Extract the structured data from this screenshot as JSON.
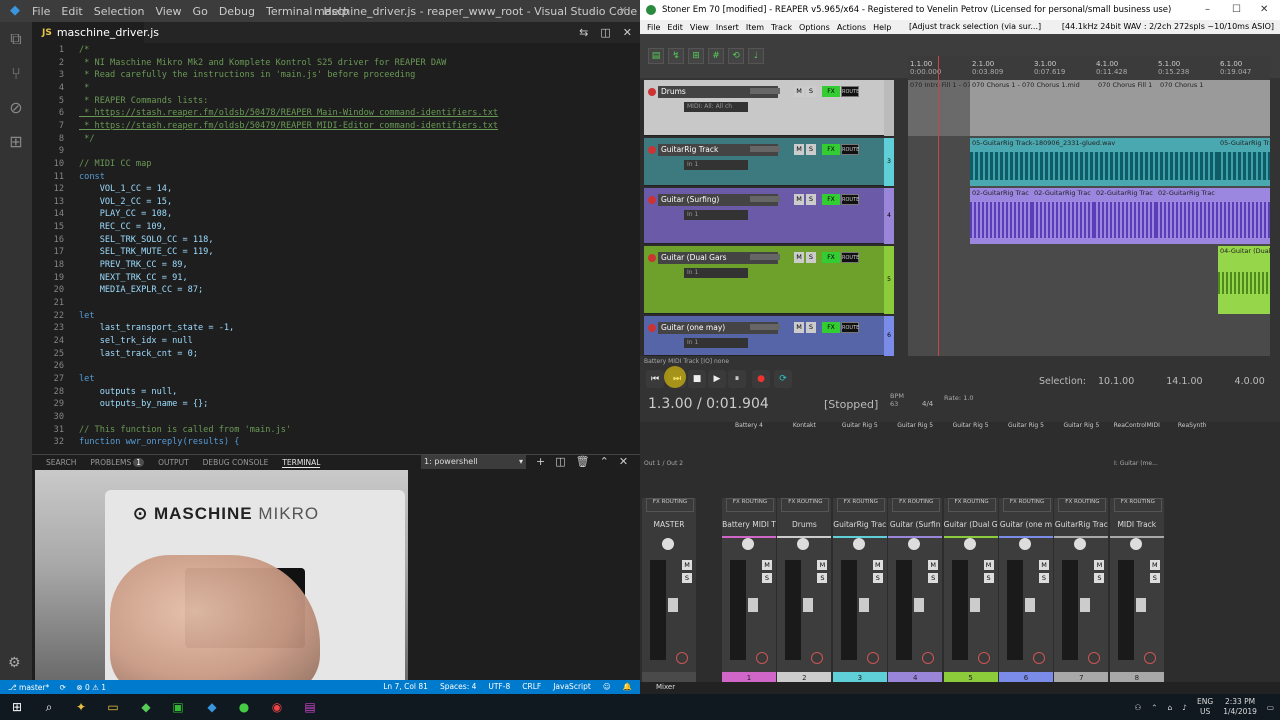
{
  "vscode": {
    "menu": [
      "File",
      "Edit",
      "Selection",
      "View",
      "Go",
      "Debug",
      "Terminal",
      "Help"
    ],
    "title": "maschine_driver.js - reaper_www_root - Visual Studio Code",
    "tab": "maschine_driver.js",
    "lines": [
      {
        "n": "1",
        "t": "/*"
      },
      {
        "n": "2",
        "t": " * NI Maschine Mikro Mk2 and Komplete Kontrol S25 driver for REAPER DAW"
      },
      {
        "n": "3",
        "t": " * Read carefully the instructions in 'main.js' before proceeding"
      },
      {
        "n": "4",
        "t": " *"
      },
      {
        "n": "5",
        "t": " * REAPER Commands lists:"
      },
      {
        "n": "6",
        "t": " * https://stash.reaper.fm/oldsb/50478/REAPER_Main-Window_command-identifiers.txt"
      },
      {
        "n": "7",
        "t": " * https://stash.reaper.fm/oldsb/50479/REAPER_MIDI-Editor_command-identifiers.txt"
      },
      {
        "n": "8",
        "t": " */"
      },
      {
        "n": "9",
        "t": ""
      },
      {
        "n": "10",
        "t": "// MIDI CC map"
      },
      {
        "n": "11",
        "t": "const"
      },
      {
        "n": "12",
        "t": "    VOL_1_CC = 14,"
      },
      {
        "n": "13",
        "t": "    VOL_2_CC = 15,"
      },
      {
        "n": "14",
        "t": "    PLAY_CC = 108,"
      },
      {
        "n": "15",
        "t": "    REC_CC = 109,"
      },
      {
        "n": "16",
        "t": "    SEL_TRK_SOLO_CC = 118,"
      },
      {
        "n": "17",
        "t": "    SEL_TRK_MUTE_CC = 119,"
      },
      {
        "n": "18",
        "t": "    PREV_TRK_CC = 89,"
      },
      {
        "n": "19",
        "t": "    NEXT_TRK_CC = 91,"
      },
      {
        "n": "20",
        "t": "    MEDIA_EXPLR_CC = 87;"
      },
      {
        "n": "21",
        "t": ""
      },
      {
        "n": "22",
        "t": "let"
      },
      {
        "n": "23",
        "t": "    last_transport_state = -1,"
      },
      {
        "n": "24",
        "t": "    sel_trk_idx = null"
      },
      {
        "n": "25",
        "t": "    last_track_cnt = 0;"
      },
      {
        "n": "26",
        "t": ""
      },
      {
        "n": "27",
        "t": "let"
      },
      {
        "n": "28",
        "t": "    outputs = null,"
      },
      {
        "n": "29",
        "t": "    outputs_by_name = {};"
      },
      {
        "n": "30",
        "t": ""
      },
      {
        "n": "31",
        "t": "// This function is called from 'main.js'"
      },
      {
        "n": "32",
        "t": "function wwr_onreply(results) {"
      }
    ],
    "panel_tabs": [
      "SEARCH",
      "PROBLEMS",
      "OUTPUT",
      "DEBUG CONSOLE",
      "TERMINAL"
    ],
    "problems_count": "1",
    "shell": "1: powershell",
    "webcam_brand": "MASCHINE",
    "webcam_brand2": "MIKRO",
    "status": {
      "branch": "master*",
      "errors": "0",
      "warnings": "1",
      "pos": "Ln 7, Col 81",
      "spaces": "Spaces: 4",
      "enc": "UTF-8",
      "eol": "CRLF",
      "lang": "JavaScript"
    }
  },
  "reaper": {
    "title": "Stoner Em 70 [modified] - REAPER v5.965/x64 - Registered to Venelin Petrov (Licensed for personal/small business use)",
    "menu": [
      "File",
      "Edit",
      "View",
      "Insert",
      "Item",
      "Track",
      "Options",
      "Actions",
      "Help"
    ],
    "menu_status": "[Adjust track selection (via sur...]",
    "audio_info": "[44.1kHz 24bit WAV : 2/2ch 272spls ~10/10ms ASIO]",
    "ruler": [
      {
        "a": "1.1.00",
        "b": "0:00.000"
      },
      {
        "a": "2.1.00",
        "b": "0:03.809"
      },
      {
        "a": "3.1.00",
        "b": "0:07.619"
      },
      {
        "a": "4.1.00",
        "b": "0:11.428"
      },
      {
        "a": "5.1.00",
        "b": "0:15.238"
      },
      {
        "a": "6.1.00",
        "b": "0:19.047"
      }
    ],
    "tracks": [
      {
        "name": "Drums",
        "input": "MIDI: All: All ch"
      },
      {
        "name": "GuitarRig Track",
        "input": "In 1"
      },
      {
        "name": "Guitar (Surfing)",
        "input": "In 1"
      },
      {
        "name": "Guitar (Dual Gars",
        "input": "In 1"
      },
      {
        "name": "Guitar (one may)",
        "input": "In 1"
      }
    ],
    "track_nums": [
      "",
      "3",
      "4",
      "5",
      "6"
    ],
    "items": {
      "drums": [
        "070 Intro Fill 1 - 070 Ch",
        "070 Chorus 1 - 070 Chorus 1.mid",
        "070 Chorus Fill 1",
        "070 Chorus 1"
      ],
      "guitarrig": [
        "05-GuitarRig Track-180906_2331-glued.wav",
        "05-GuitarRig Track"
      ],
      "surfing": [
        "02-GuitarRig Trac",
        "02-GuitarRig Trac",
        "02-GuitarRig Trac",
        "02-GuitarRig Trac"
      ],
      "dual": [
        "04-Guitar (Dual"
      ]
    },
    "transport_note": "Battery MIDI Track [IO] none",
    "time": "1.3.00 / 0:01.904",
    "state": "[Stopped]",
    "bpm_label": "BPM",
    "bpm": "63",
    "sig": "4/4",
    "rate_label": "Rate:",
    "rate": "1.0",
    "selection_label": "Selection:",
    "selection": [
      "10.1.00",
      "14.1.00",
      "4.0.00"
    ],
    "instruments": [
      "Battery 4",
      "Kontakt",
      "Guitar Rig 5",
      "Guitar Rig 5",
      "Guitar Rig 5",
      "Guitar Rig 5",
      "Guitar Rig 5",
      "ReaControlMIDI",
      "ReaSynth"
    ],
    "mixer_strips": [
      {
        "name": "MASTER",
        "num": "",
        "color": "#4a4a4a"
      },
      {
        "name": "Battery MIDI T",
        "num": "1",
        "color": "#d066c8"
      },
      {
        "name": "Drums",
        "num": "2",
        "color": "#cccccc"
      },
      {
        "name": "GuitarRig Trac",
        "num": "3",
        "color": "#5fd0d8"
      },
      {
        "name": "Guitar (Surfin",
        "num": "4",
        "color": "#9a86d8"
      },
      {
        "name": "Guitar (Dual G",
        "num": "5",
        "color": "#8ccc3a"
      },
      {
        "name": "Guitar (one m",
        "num": "6",
        "color": "#7a8ce8"
      },
      {
        "name": "GuitarRig Trac",
        "num": "7",
        "color": "#a8a8a8"
      },
      {
        "name": "MIDI Track",
        "num": "8",
        "color": "#a8a8a8"
      }
    ],
    "mixer_tab": "Mixer",
    "out_label": "Out 1 / Out 2",
    "in_label": "I: Guitar (me..."
  },
  "taskbar": {
    "lang": "ENG",
    "region": "US",
    "time": "2:33 PM",
    "date": "1/4/2019"
  }
}
